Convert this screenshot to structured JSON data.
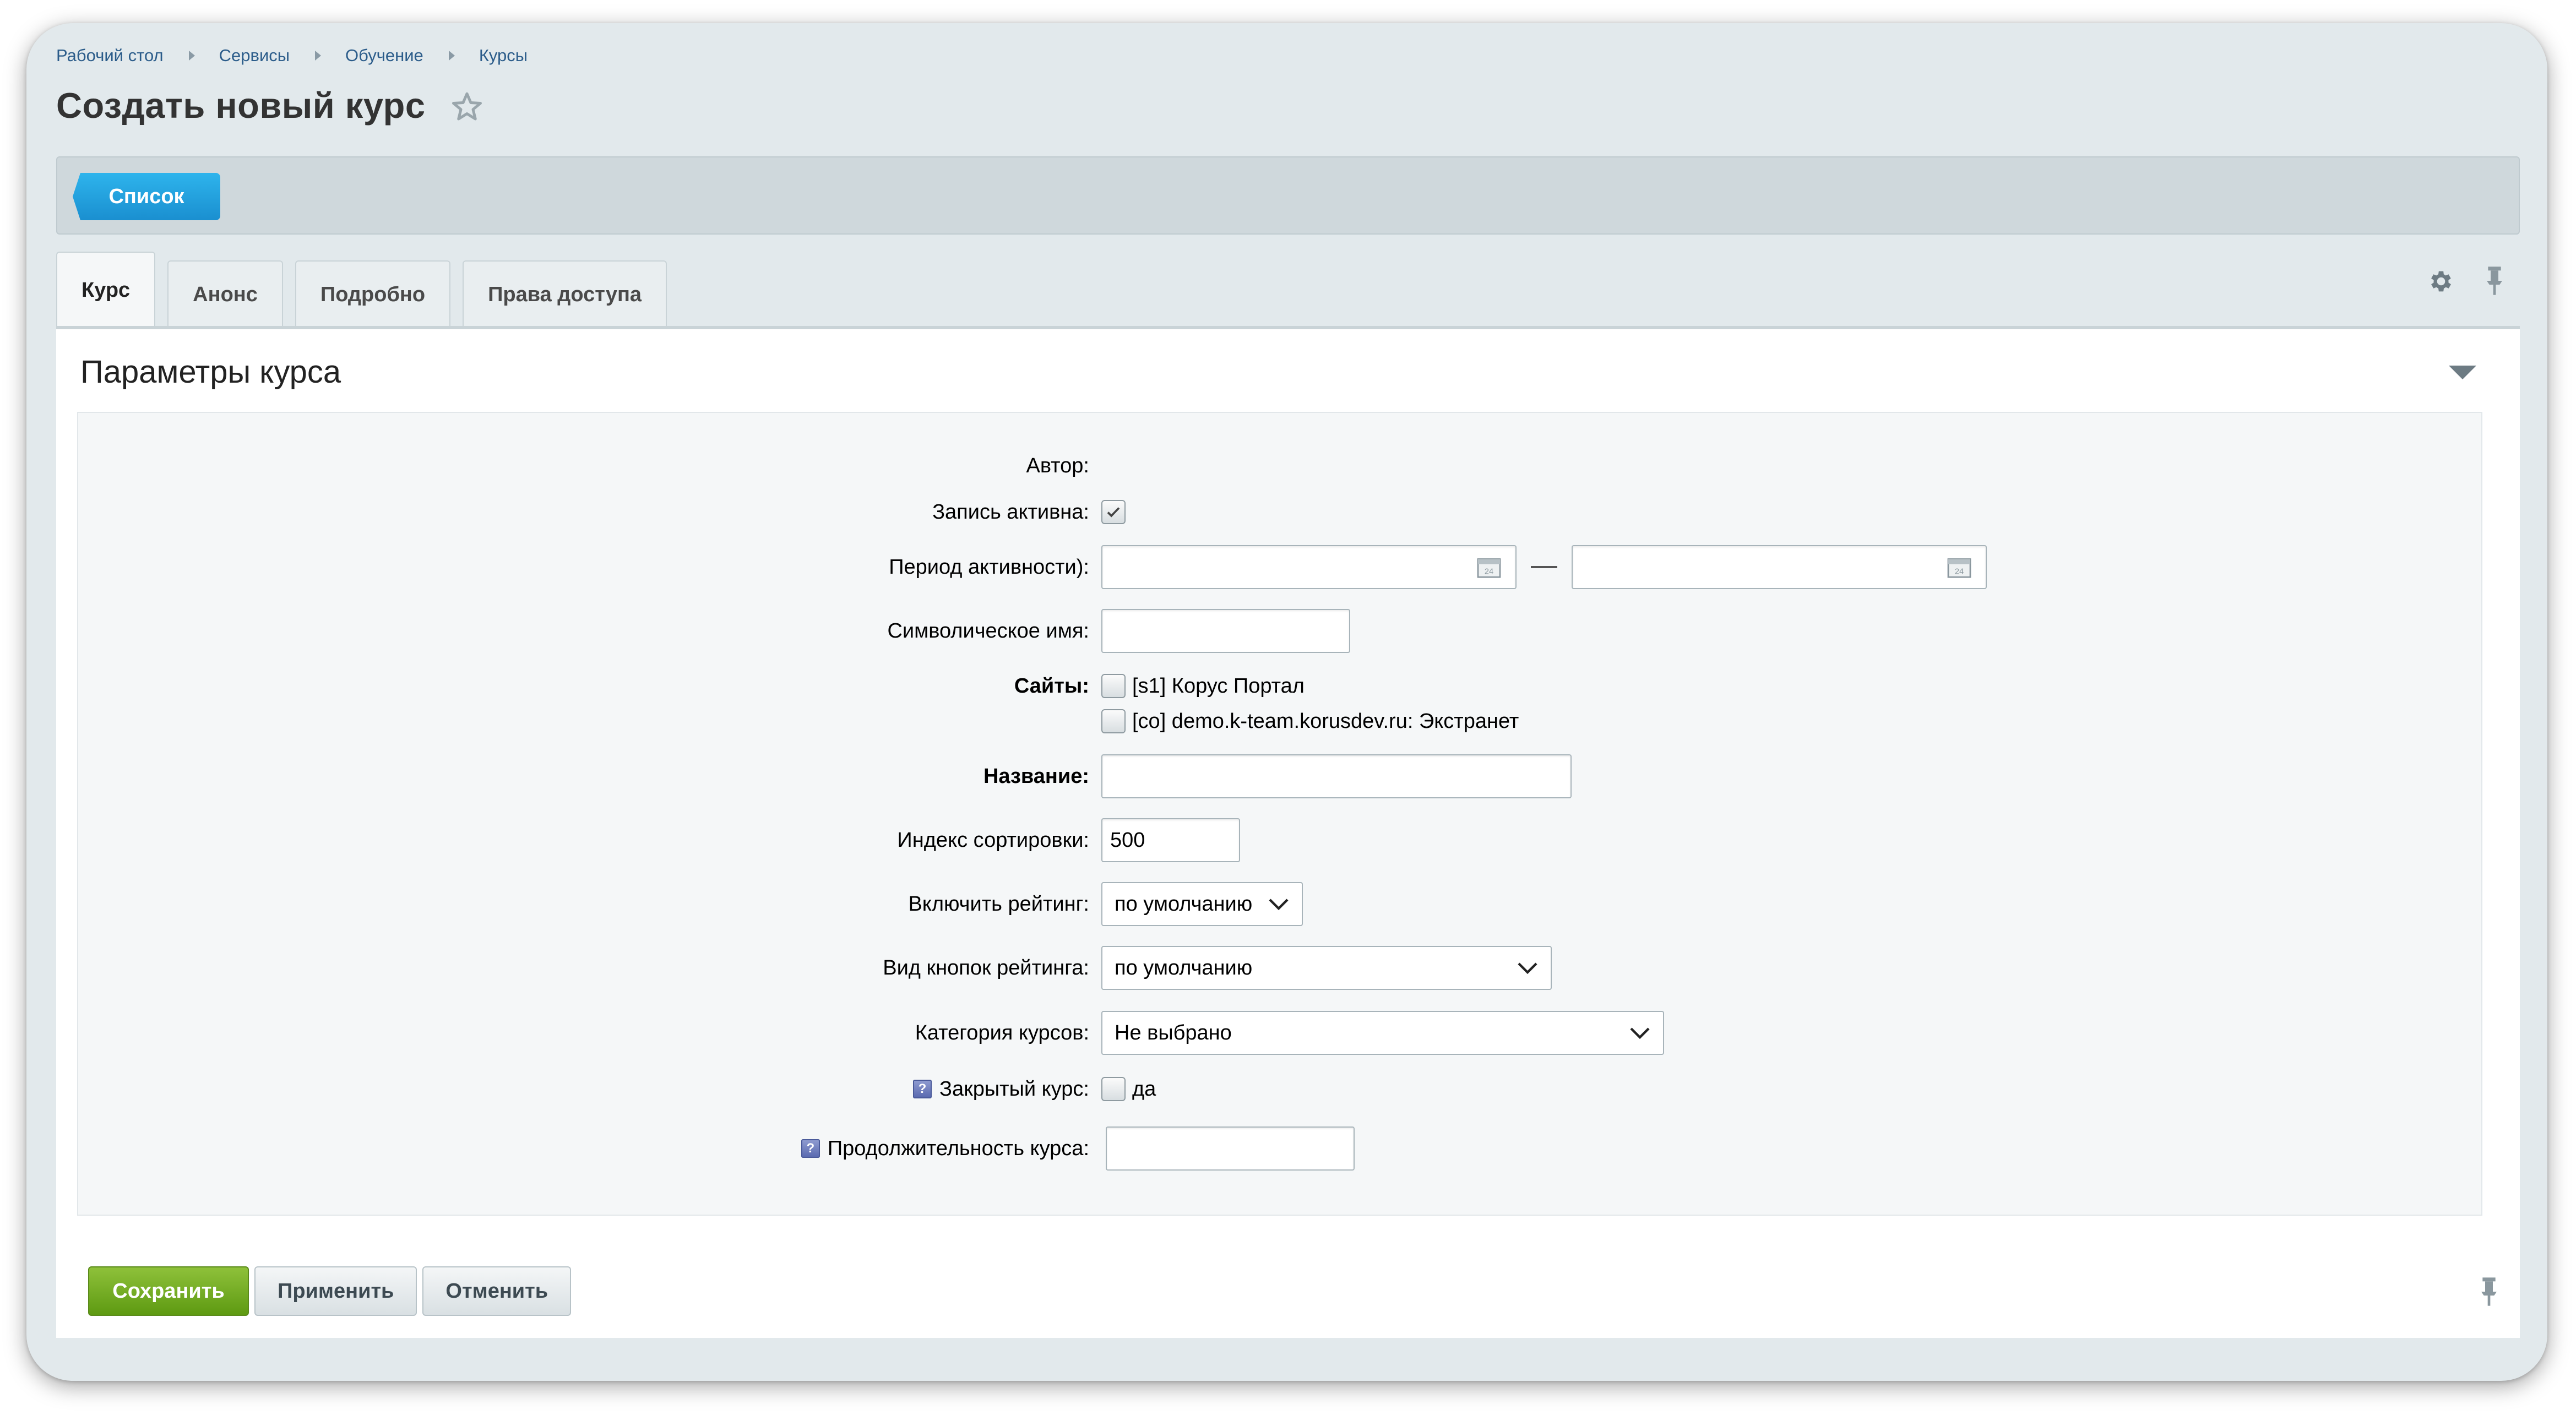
{
  "breadcrumb": [
    "Рабочий стол",
    "Сервисы",
    "Обучение",
    "Курсы"
  ],
  "page_title": "Создать новый курс",
  "toolbar": {
    "list_button": "Список"
  },
  "tabs": [
    "Курс",
    "Анонс",
    "Подробно",
    "Права доступа"
  ],
  "active_tab": "Курс",
  "section": {
    "title": "Параметры курса"
  },
  "form": {
    "author_label": "Автор:",
    "active_label": "Запись активна:",
    "active_checked": true,
    "period_label": "Период активности):",
    "period_from": "",
    "period_to": "",
    "code_label": "Символическое имя:",
    "code_value": "",
    "sites_label": "Сайты:",
    "sites": [
      {
        "label": "[s1] Корус Портал",
        "checked": false
      },
      {
        "label": "[co] demo.k-team.korusdev.ru: Экстранет",
        "checked": false
      }
    ],
    "name_label": "Название:",
    "name_value": "",
    "sort_label": "Индекс сортировки:",
    "sort_value": "500",
    "rating_label": "Включить рейтинг:",
    "rating_value": "по умолчанию",
    "rating_type_label": "Вид кнопок рейтинга:",
    "rating_type_value": "по умолчанию",
    "category_label": "Категория курсов:",
    "category_value": "Не выбрано",
    "closed_label": "Закрытый курс:",
    "closed_option": "да",
    "closed_checked": false,
    "duration_label": "Продолжительность курса:",
    "duration_value": ""
  },
  "actions": {
    "save": "Сохранить",
    "apply": "Применить",
    "cancel": "Отменить"
  },
  "icons": {
    "star": "star-outline-icon",
    "settings": "gear-icon",
    "pin": "pin-icon",
    "calendar": "calendar-icon",
    "help": "help-icon"
  },
  "colors": {
    "accent_blue": "#1a9ad9",
    "save_green": "#6faa1c",
    "link": "#2b5c8a"
  }
}
